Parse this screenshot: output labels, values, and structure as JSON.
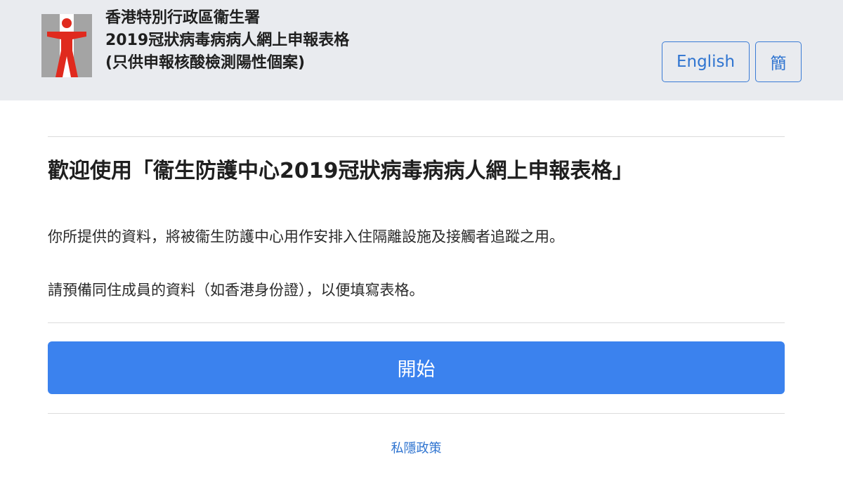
{
  "header": {
    "title_line1": "香港特別行政區衞生署",
    "title_line2": "2019冠狀病毒病病人網上申報表格",
    "title_line3": "(只供申報核酸檢測陽性個案)",
    "logo_icon": "department-of-health-logo-icon",
    "english_label": "English",
    "simplified_label": "簡"
  },
  "main": {
    "welcome_heading": "歡迎使用「衞生防護中心2019冠狀病毒病病人網上申報表格」",
    "paragraph1": "你所提供的資料，將被衞生防護中心用作安排入住隔離設施及接觸者追蹤之用。",
    "paragraph2": "請預備同住成員的資料（如香港身份證），以便填寫表格。",
    "start_label": "開始",
    "privacy_label": "私隱政策"
  },
  "colors": {
    "header_bg": "#e9ebef",
    "accent": "#3b82ee",
    "link": "#2f74d0",
    "logo_red": "#e02a1e",
    "logo_grey": "#a4a4a4"
  }
}
